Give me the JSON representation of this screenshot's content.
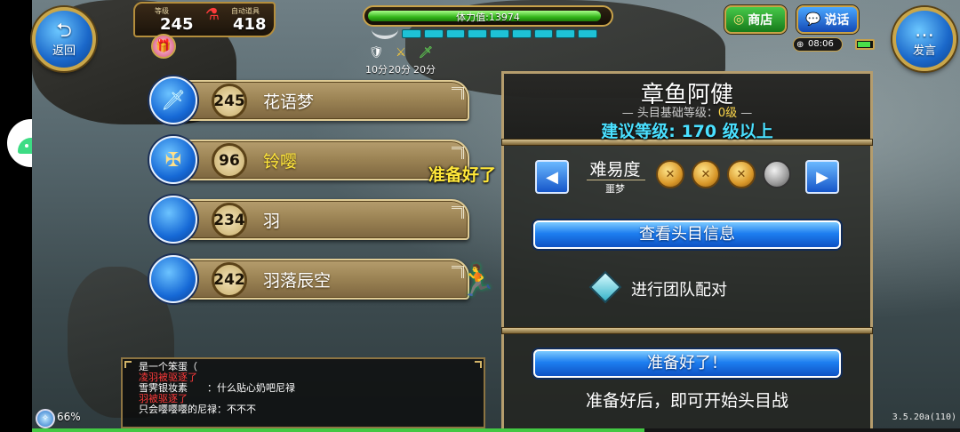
{
  "hud": {
    "back_label": "返回",
    "back_glyph": "⮌",
    "speak_label": "发言",
    "speak_glyph": "…",
    "level_label": "等级",
    "level_value": "245",
    "auto_potion_label": "自动道具",
    "auto_potion_value": "418",
    "stamina_label": "体力值:13974",
    "stamina_fraction": 0.97,
    "buffs": [
      {
        "icon": "shield-icon",
        "glyph": "🛡",
        "label": "10分"
      },
      {
        "icon": "sword-gold-icon",
        "glyph": "⚔",
        "label": "20分"
      },
      {
        "icon": "sword-green-icon",
        "glyph": "🗡",
        "label": "20分"
      }
    ],
    "shop_label": "商店",
    "talk_label": "说话",
    "clock": "08:06",
    "battery_fraction": 0.85,
    "xp_percent": "66%",
    "xp_fraction": 0.66,
    "version": "3.5.20a(110)"
  },
  "boss_list": [
    {
      "level": "245",
      "name": "花语梦",
      "icon": "sword-icon",
      "glyph": "🗡",
      "highlight": false
    },
    {
      "level": "96",
      "name": "铃嘤",
      "icon": "crossbow-icon",
      "glyph": "✠",
      "highlight": true
    },
    {
      "level": "234",
      "name": "羽",
      "icon": "empty-orb-icon",
      "glyph": "",
      "highlight": false
    },
    {
      "level": "242",
      "name": "羽落辰空",
      "icon": "empty-orb-icon",
      "glyph": "",
      "highlight": false
    }
  ],
  "floating_text": "准备好了",
  "boss_panel": {
    "name": "章鱼阿健",
    "base_level_prefix": "— 头目基础等级：",
    "base_level_value": "0级",
    "base_level_suffix": " —",
    "recommended": "建议等级: 170 级以上",
    "difficulty_label": "难易度",
    "difficulty_sub": "噩梦",
    "difficulty_filled": 3,
    "difficulty_total": 4,
    "view_info_label": "查看头目信息",
    "team_match_label": "进行团队配对",
    "ready_label": "准备好了！",
    "ready_hint": "准备好后，即可开始头目战"
  },
  "chat": [
    {
      "text": "是一个笨蛋（",
      "color": "white"
    },
    {
      "text": "凌羽被驱逐了",
      "color": "red"
    },
    {
      "text": "雪霁银妆素　　：什么贴心奶吧尼禄",
      "color": "white"
    },
    {
      "text": "羽被驱逐了",
      "color": "red"
    },
    {
      "text": "只会嘤嘤嘤的尼禄：不不不",
      "color": "white"
    }
  ]
}
